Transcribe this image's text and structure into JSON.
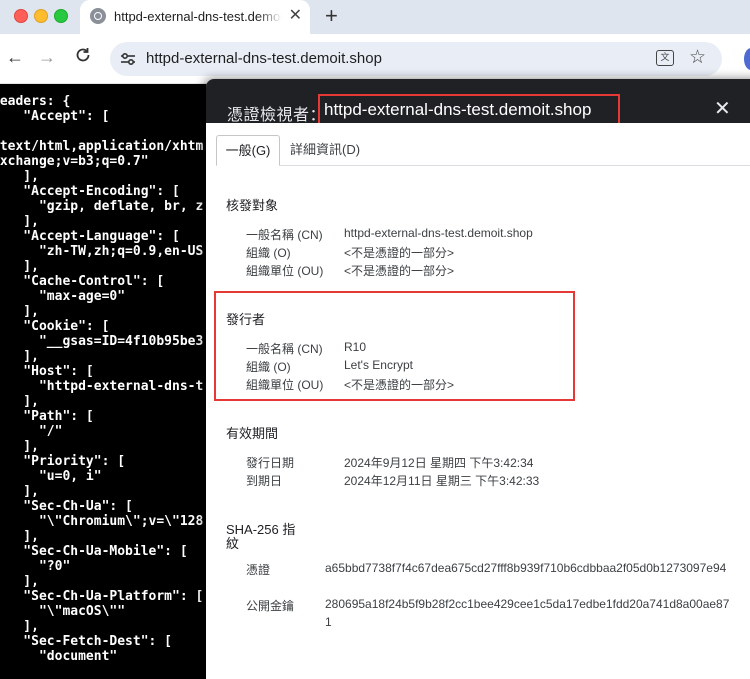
{
  "browser": {
    "tab_title": "httpd-external-dns-test.demoit.shop",
    "url": "httpd-external-dns-test.demoit.shop"
  },
  "page_code": [
    "headers: {",
    "    \"Accept\": [",
    "",
    "'text/html,application/xhtm",
    "exchange;v=b3;q=0.7\"",
    "    ],",
    "    \"Accept-Encoding\": [",
    "      \"gzip, deflate, br, z",
    "    ],",
    "    \"Accept-Language\": [",
    "      \"zh-TW,zh;q=0.9,en-US",
    "    ],",
    "    \"Cache-Control\": [",
    "      \"max-age=0\"",
    "    ],",
    "    \"Cookie\": [",
    "      \"__gsas=ID=4f10b95be3",
    "    ],",
    "    \"Host\": [",
    "      \"httpd-external-dns-t",
    "    ],",
    "    \"Path\": [",
    "      \"/\"",
    "    ],",
    "    \"Priority\": [",
    "      \"u=0, i\"",
    "    ],",
    "    \"Sec-Ch-Ua\": [",
    "      \"\\\"Chromium\\\";v=\\\"128",
    "    ],",
    "    \"Sec-Ch-Ua-Mobile\": [",
    "      \"?0\"",
    "    ],",
    "    \"Sec-Ch-Ua-Platform\": [",
    "      \"\\\"macOS\\\"\"",
    "    ],",
    "    \"Sec-Fetch-Dest\": [",
    "      \"document\""
  ],
  "dialog": {
    "title_prefix": "憑證檢視者：",
    "title_host": "httpd-external-dns-test.demoit.shop",
    "tabs": {
      "general": "一般(G)",
      "details": "詳細資訊(D)"
    },
    "issued_to": {
      "heading": "核發對象",
      "rows": [
        {
          "label": "一般名稱 (CN)",
          "value": "httpd-external-dns-test.demoit.shop"
        },
        {
          "label": "組織 (O)",
          "value": "<不是憑證的一部分>"
        },
        {
          "label": "組織單位 (OU)",
          "value": "<不是憑證的一部分>"
        }
      ]
    },
    "issued_by": {
      "heading": "發行者",
      "rows": [
        {
          "label": "一般名稱 (CN)",
          "value": "R10"
        },
        {
          "label": "組織 (O)",
          "value": "Let's Encrypt"
        },
        {
          "label": "組織單位 (OU)",
          "value": "<不是憑證的一部分>"
        }
      ]
    },
    "validity": {
      "heading": "有效期間",
      "rows": [
        {
          "label": "發行日期",
          "value": "2024年9月12日 星期四 下午3:42:34"
        },
        {
          "label": "到期日",
          "value": "2024年12月11日 星期三 下午3:42:33"
        }
      ]
    },
    "fingerprints": {
      "heading_line1": "SHA-256 指",
      "heading_line2": "紋",
      "rows": [
        {
          "label": "憑證",
          "value": "a65bbd7738f7f4c67dea675cd27fff8b939f710b6cdbbaa2f05d0b1273097e94"
        },
        {
          "label": "公開金鑰",
          "value": "280695a18f24b5f9b28f2cc1bee429cee1c5da17edbe1fdd20a741d8a00ae871"
        }
      ]
    }
  }
}
